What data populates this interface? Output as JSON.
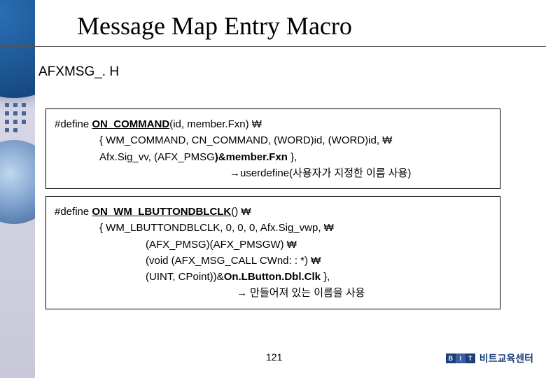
{
  "title": "Message Map Entry Macro",
  "subtitle": "AFXMSG_. H",
  "box1": {
    "line1_pre": "#define ",
    "line1_bold": "ON_COMMAND",
    "line1_post": "(id, member.Fxn) ₩",
    "line2": "{ WM_COMMAND, CN_COMMAND, (WORD)id, (WORD)id, ₩",
    "line3_pre": "Afx.Sig_vv, (AFX_PMSG",
    "line3_bold": ")&member.Fxn",
    "line3_post": " },",
    "line4_arrow": "→",
    "line4_text": "userdefine(사용자가 지정한 이름 사용)"
  },
  "box2": {
    "line1_pre": "#define ",
    "line1_bold": "ON_WM_LBUTTONDBLCLK",
    "line1_post": "() ₩",
    "line2": "{ WM_LBUTTONDBLCLK, 0, 0, 0, Afx.Sig_vwp, ₩",
    "line3": "(AFX_PMSG)(AFX_PMSGW) ₩",
    "line4": "(void (AFX_MSG_CALL CWnd: : *) ₩",
    "line5_pre": "(UINT, CPoint))&",
    "line5_bold": "On.LButton.Dbl.Clk",
    "line5_post": " },",
    "line6_arrow": "→",
    "line6_text": " 만들어져 있는 이름을 사용"
  },
  "page_number": "121",
  "logo": {
    "b": "B",
    "i": "I",
    "t": "T",
    "text": "비트교육센터"
  }
}
